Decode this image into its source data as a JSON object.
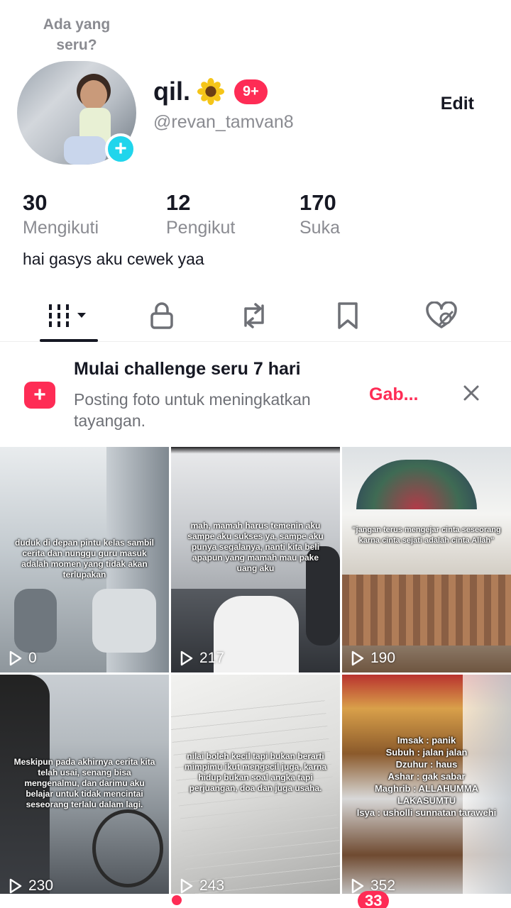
{
  "status": {
    "prompt": "Ada yang seru?"
  },
  "profile": {
    "display_name": "qil.",
    "notification_count": "9+",
    "username": "@revan_tamvan8",
    "edit_label": "Edit",
    "bio": "hai gasys aku cewek yaa"
  },
  "stats": [
    {
      "value": "30",
      "label": "Mengikuti"
    },
    {
      "value": "12",
      "label": "Pengikut"
    },
    {
      "value": "170",
      "label": "Suka"
    }
  ],
  "tabs": [
    {
      "icon": "grid-icon",
      "active": true
    },
    {
      "icon": "lock-icon",
      "active": false
    },
    {
      "icon": "repost-icon",
      "active": false
    },
    {
      "icon": "bookmark-icon",
      "active": false
    },
    {
      "icon": "liked-hidden-icon",
      "active": false
    }
  ],
  "banner": {
    "title": "Mulai challenge seru 7 hari",
    "description": "Posting foto untuk meningkatkan tayangan.",
    "join_label": "Gab...",
    "icon": "add-box-icon"
  },
  "videos": [
    {
      "views": "0",
      "caption": "duduk di depan pintu kelas sambil cerita dan nunggu guru masuk adalah momen yang tidak akan terlupakan"
    },
    {
      "views": "217",
      "caption": "mah, mamah harus temenin aku sampe aku sukses ya, sampe aku punya segalanya, nanti kita beli apapun yang mamah mau pake uang aku"
    },
    {
      "views": "190",
      "caption": "\"jangan terus mengejar cinta seseorang karna cinta sejati adalah cinta Allah\""
    },
    {
      "views": "230",
      "caption": "Meskipun pada akhirnya cerita kita telah usai, senang bisa mengenalmu, dan darimu aku belajar untuk tidak mencintai seseorang terlalu dalam lagi."
    },
    {
      "views": "243",
      "caption": "nilai boleh kecil tapi bukan berarti mimpimu ikut mengecil juga, karna hidup bukan soal angka tapi perjuangan, doa dan juga usaha."
    },
    {
      "views": "352",
      "caption": "Imsak : panik\nSubuh : jalan jalan\nDzuhur : haus\nAshar : gak sabar\nMaghrib : ALLAHUMMA LAKASUMTU\nIsya : usholli sunnatan tarawehi"
    }
  ],
  "nav": {
    "inbox_count": "33"
  },
  "colors": {
    "accent": "#fe2c55",
    "cyan": "#20d5ec",
    "muted": "#8a8b91"
  }
}
